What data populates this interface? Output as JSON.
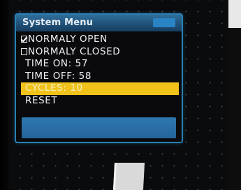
{
  "menu": {
    "title": "System Menu",
    "items": [
      {
        "label": "NORMALY OPEN",
        "checkbox": true,
        "checked": true
      },
      {
        "label": "NORMALY CLOSED",
        "checkbox": true,
        "checked": false
      },
      {
        "label": "TIME ON: 57",
        "checkbox": false
      },
      {
        "label": "TIME OFF: 58",
        "checkbox": false
      },
      {
        "label": "CYCLES: 10",
        "checkbox": false,
        "selected": true
      },
      {
        "label": "RESET",
        "checkbox": false
      }
    ]
  },
  "colors": {
    "window_border": "#2a7fb2",
    "title_bar": "#1f4f77",
    "selection_highlight": "#f0c21a",
    "bottom_bar": "#2a6fa6",
    "text": "#eef0f2"
  }
}
